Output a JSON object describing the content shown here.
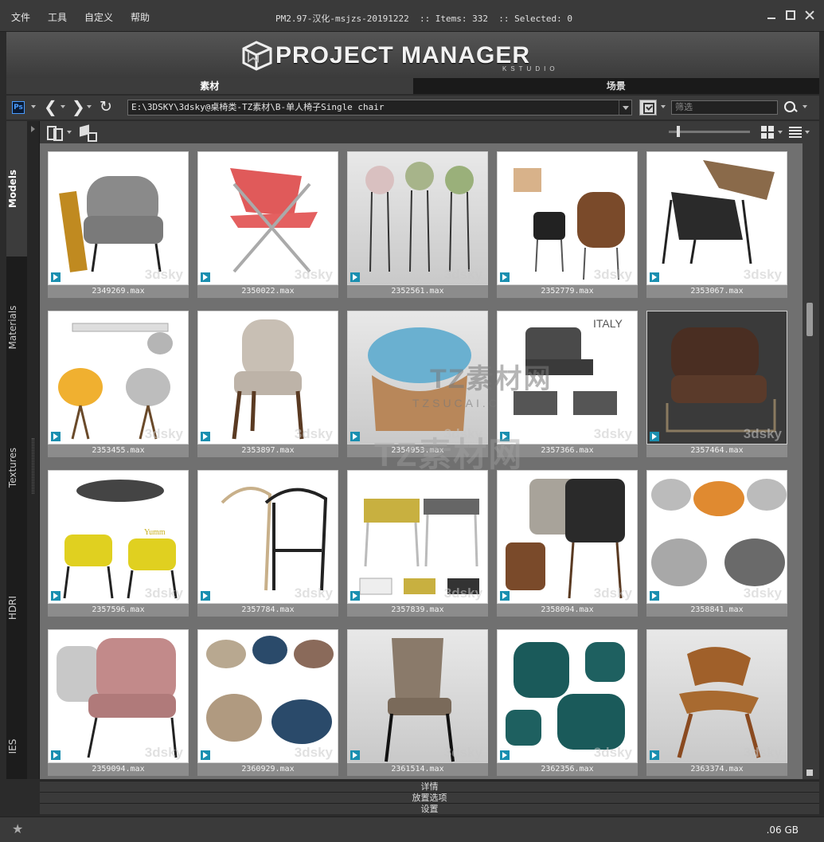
{
  "menu": [
    "文件",
    "工具",
    "自定义",
    "帮助"
  ],
  "window_title": "PM2.97-汉化-msjzs-20191222  :: Items: 332  :: Selected: 0",
  "logo": {
    "title": "PROJECT MANAGER",
    "subtitle": "KSTUDIO"
  },
  "tabs": [
    {
      "label": "素材",
      "active": true
    },
    {
      "label": "场景",
      "active": false
    }
  ],
  "toolbar": {
    "app_badge": "Ps",
    "back_arrow": "❮",
    "forward_arrow": "❯",
    "refresh": "↻",
    "path": "E:\\3DSKY\\3dsky@桌椅类-TZ素材\\B-单人椅子Single chair",
    "filter_placeholder": "筛选"
  },
  "side_tabs": [
    {
      "label": "Models",
      "active": true
    },
    {
      "label": "Materials",
      "active": false
    },
    {
      "label": "Textures",
      "active": false
    },
    {
      "label": "HDRI",
      "active": false
    },
    {
      "label": "IES",
      "active": false
    }
  ],
  "thumbnail_size": {
    "value": 0.1
  },
  "items": [
    {
      "name": "2349269.max",
      "style": "white",
      "art": "armchair-grey"
    },
    {
      "name": "2350022.max",
      "style": "white",
      "art": "chair-red"
    },
    {
      "name": "2352561.max",
      "style": "grey",
      "art": "bar-stools"
    },
    {
      "name": "2352779.max",
      "style": "white",
      "art": "chairs-set"
    },
    {
      "name": "2353067.max",
      "style": "white",
      "art": "lounge-black"
    },
    {
      "name": "2353455.max",
      "style": "white",
      "art": "dining-yellow"
    },
    {
      "name": "2353897.max",
      "style": "white",
      "art": "chair-beige"
    },
    {
      "name": "2354953.max",
      "style": "grey",
      "art": "chair-blue"
    },
    {
      "name": "2357366.max",
      "style": "white",
      "art": "armchair-italy"
    },
    {
      "name": "2357464.max",
      "style": "dark",
      "art": "leather-brown"
    },
    {
      "name": "2357596.max",
      "style": "white",
      "art": "dining-yumm"
    },
    {
      "name": "2357784.max",
      "style": "white",
      "art": "wire-chairs"
    },
    {
      "name": "2357839.max",
      "style": "white",
      "art": "metal-chairs"
    },
    {
      "name": "2358094.max",
      "style": "white",
      "art": "tufted-chairs"
    },
    {
      "name": "2358841.max",
      "style": "white",
      "art": "round-armchairs"
    },
    {
      "name": "2359094.max",
      "style": "white",
      "art": "pink-chair"
    },
    {
      "name": "2360929.max",
      "style": "white",
      "art": "tub-chairs"
    },
    {
      "name": "2361514.max",
      "style": "grey",
      "art": "tall-chair"
    },
    {
      "name": "2362356.max",
      "style": "white",
      "art": "velvet-teal"
    },
    {
      "name": "2363374.max",
      "style": "grey",
      "art": "plywood-chair"
    }
  ],
  "watermark": {
    "small": "3dsky",
    "overlay_main": "TZ素材网",
    "overlay_sub": "TZSUCAI.C"
  },
  "bottom_panels": [
    "详情",
    "放置选项",
    "设置"
  ],
  "status": {
    "star": "★",
    "disk": ".06 GB"
  },
  "colors": {
    "accent_ps": "#4a9cff",
    "max_icon": "#1a8fb0"
  }
}
